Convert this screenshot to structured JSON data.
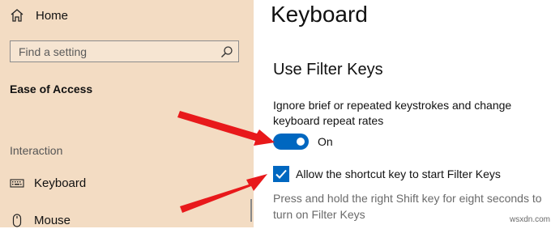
{
  "sidebar": {
    "home_label": "Home",
    "search_placeholder": "Find a setting",
    "section_title": "Ease of Access",
    "group_label": "Interaction",
    "items": [
      {
        "label": "Keyboard",
        "icon": "keyboard-icon"
      },
      {
        "label": "Mouse",
        "icon": "mouse-icon"
      }
    ]
  },
  "main": {
    "title": "Keyboard",
    "subtitle": "Use Filter Keys",
    "description": "Ignore brief or repeated keystrokes and change keyboard repeat rates",
    "toggle_state": "On",
    "checkbox_label": "Allow the shortcut key to start Filter Keys",
    "help_text": "Press and hold the right Shift key for eight seconds to turn on Filter Keys"
  },
  "watermark": "wsxdn.com",
  "colors": {
    "sidebar_bg": "#f3dcc3",
    "accent": "#0067c0",
    "annotation_arrow": "#e8191b"
  }
}
